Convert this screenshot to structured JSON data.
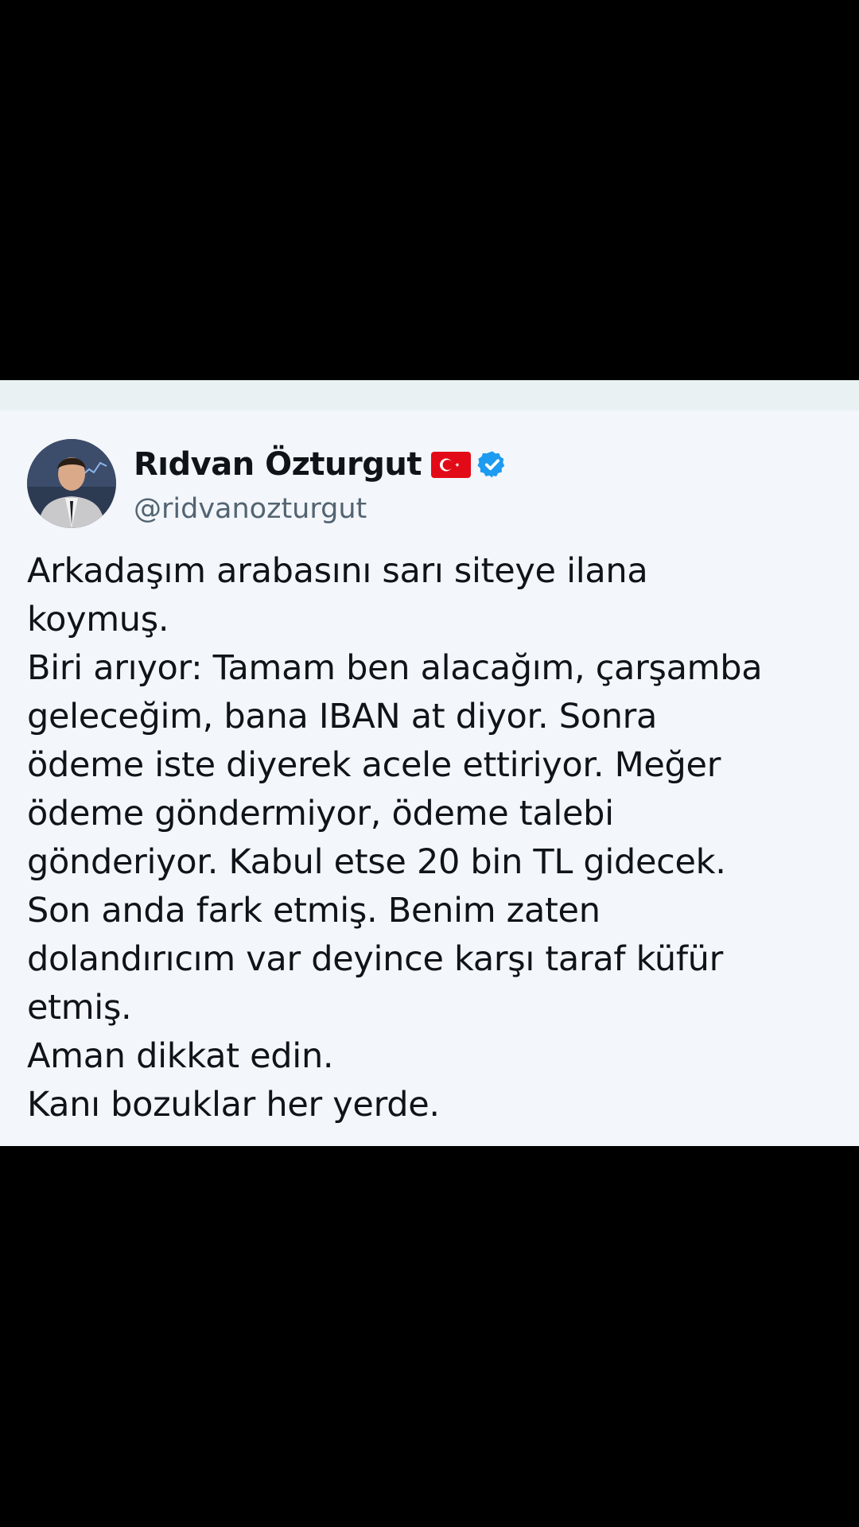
{
  "tweet": {
    "author": {
      "display_name": "Rıdvan Özturgut",
      "handle": "@ridvanozturgut",
      "flag_icon": "turkey-flag-icon",
      "verified_icon": "verified-badge-icon",
      "verified_color": "#1d9bf0"
    },
    "lines": [
      "Arkadaşım arabasını sarı siteye ilana",
      "koymuş.",
      "Biri arıyor: Tamam ben alacağım, çarşamba",
      "geleceğim, bana IBAN at diyor. Sonra",
      "ödeme iste diyerek acele ettiriyor. Meğer",
      "ödeme göndermiyor, ödeme talebi",
      "gönderiyor. Kabul etse 20 bin TL gidecek.",
      "Son anda fark etmiş. Benim zaten",
      "dolandırıcım var deyince karşı taraf küfür",
      "etmiş.",
      "Aman dikkat edin.",
      "Kanı bozuklar her yerde."
    ]
  },
  "colors": {
    "background": "#000000",
    "card": "#f3f6fb",
    "text": "#0f1419",
    "secondary_text": "#536471"
  }
}
